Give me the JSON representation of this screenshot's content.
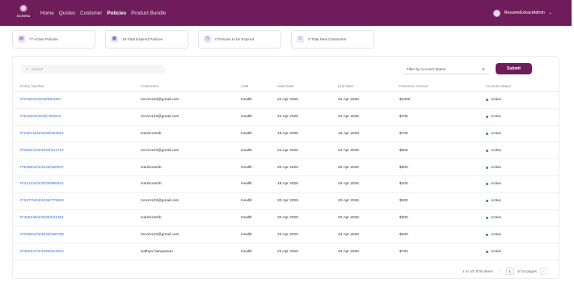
{
  "brand": {
    "logo_text": "XCEIRA"
  },
  "nav": {
    "items": [
      "Home",
      "Quotes",
      "Customer",
      "Policies",
      "Product Bundle"
    ],
    "active": "Policies"
  },
  "user": {
    "name": "ResumeExtractAdmin"
  },
  "stats": [
    {
      "label": "77 Active Policies",
      "icon": "policy-icon"
    },
    {
      "label": "19 Total Expired Policies",
      "icon": "calendar-icon"
    },
    {
      "label": "0 Policies to be Expired",
      "icon": "clock-icon"
    },
    {
      "label": "0 Total New Customers",
      "icon": "users-icon"
    }
  ],
  "toolbar": {
    "search_placeholder": "Search",
    "filter_label": "Filter by Account Status",
    "submit_label": "Submit"
  },
  "table": {
    "headers": [
      "Policy Number",
      "Customers",
      "LOB",
      "Start Date",
      "End Date",
      "Premium Amount",
      "Account Status"
    ],
    "rows": [
      [
        "P/242504/2025/661093",
        "mcvm123@gmail.com",
        "Health",
        "24 Apr 2025",
        "24 Apr 2026",
        "$1000",
        "Active"
      ],
      [
        "P/918204/2025/783019",
        "mcvm123@gmail.com",
        "Health",
        "24 Apr 2025",
        "24 Apr 2026",
        "$700",
        "Active"
      ],
      [
        "P/180719/4/2025/283581",
        "Harelcosmb",
        "Health",
        "18 Apr 2025",
        "18 Apr 2026",
        "$700",
        "Active"
      ],
      [
        "P/280472/4/2025/441747",
        "mcvm123@gmail.com",
        "Health",
        "24 Apr 2025",
        "24 Apr 2026",
        "$600",
        "Active"
      ],
      [
        "P/938624/4/2025/280537",
        "Harelcosmb",
        "Health",
        "20 Apr 2025",
        "20 Apr 2026",
        "$900",
        "Active"
      ],
      [
        "P/421224/4/2025/880521",
        "Harelcosmb",
        "Health",
        "18 Apr 2025",
        "18 Apr 2026",
        "$400",
        "Active"
      ],
      [
        "P/197750/4/2025/779620",
        "mcvm123@gmail.com",
        "Health",
        "20 Apr 2025",
        "20 Apr 2026",
        "$300",
        "Active"
      ],
      [
        "P/465349/4/2025/541351",
        "Harelcosmb",
        "Health",
        "20 Apr 2025",
        "20 Apr 2026",
        "$300",
        "Active"
      ],
      [
        "P/328002/4/2025/280796",
        "mcvm123@gmail.com",
        "Health",
        "23 Apr 2025",
        "23 Apr 2026",
        "$200",
        "Active"
      ],
      [
        "P/460247/4/2025/612012",
        "Sathya Narayanan",
        "Health",
        "23 Apr 2025",
        "23 Apr 2026",
        "$794",
        "Active"
      ]
    ]
  },
  "pagination": {
    "range_text": "1 to 10 of 55 items",
    "current_page": "1",
    "of_pages": "of 10 pages",
    "prev": "‹",
    "next": "›"
  },
  "colors": {
    "brand": "#6e1d5a",
    "link": "#3b6fd6",
    "active_dot": "#1f9d55"
  }
}
